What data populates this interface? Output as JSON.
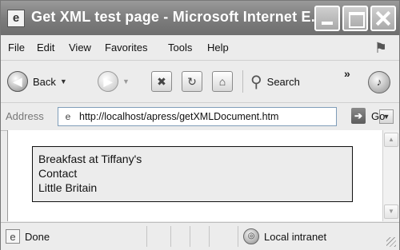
{
  "window": {
    "title": "Get XML test page - Microsoft Internet E...",
    "title_icon": "ie-page-icon"
  },
  "menu": {
    "items": [
      "File",
      "Edit",
      "View",
      "Favorites",
      "Tools",
      "Help"
    ]
  },
  "toolbar": {
    "back_label": "Back",
    "search_label": "Search",
    "chevron": "»"
  },
  "address": {
    "label": "Address",
    "url": "http://localhost/apress/getXMLDocument.htm",
    "go_label": "Go"
  },
  "content": {
    "lines": [
      "Breakfast at Tiffany's",
      "Contact",
      "Little Britain"
    ]
  },
  "status": {
    "text": "Done",
    "zone": "Local intranet"
  }
}
